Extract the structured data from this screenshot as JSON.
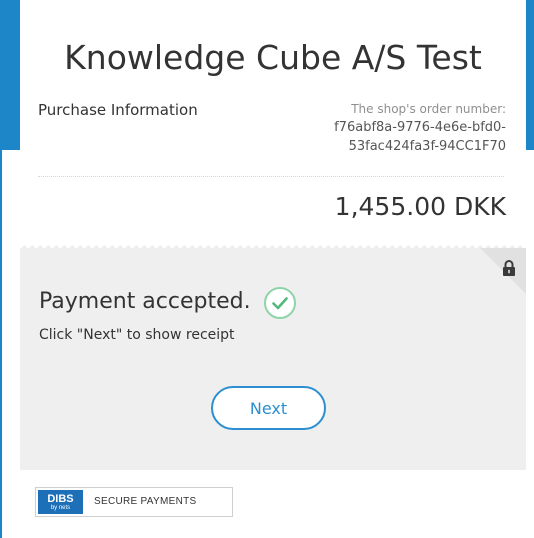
{
  "shop": {
    "title": "Knowledge Cube A/S Test"
  },
  "purchase": {
    "section_label": "Purchase Information",
    "order_number_label": "The shop's order number:",
    "order_number_line1": "f76abf8a-9776-4e6e-bfd0-",
    "order_number_line2": "53fac424fa3f-94CC1F70",
    "amount": "1,455.00 DKK"
  },
  "status": {
    "message": "Payment accepted.",
    "instruction": "Click \"Next\" to show receipt",
    "next_button_label": "Next",
    "icons": {
      "lock": "lock-icon",
      "check": "checkmark-circle-icon"
    }
  },
  "footer": {
    "brand_name": "DIBS",
    "brand_sub": "by nets",
    "secure_label": "SECURE PAYMENTS"
  },
  "colors": {
    "accent_blue": "#1d86c9",
    "button_blue": "#2b8fd1",
    "success_green": "#54b87c",
    "panel_gray": "#efefef",
    "dibs_blue": "#1d6fb8"
  }
}
